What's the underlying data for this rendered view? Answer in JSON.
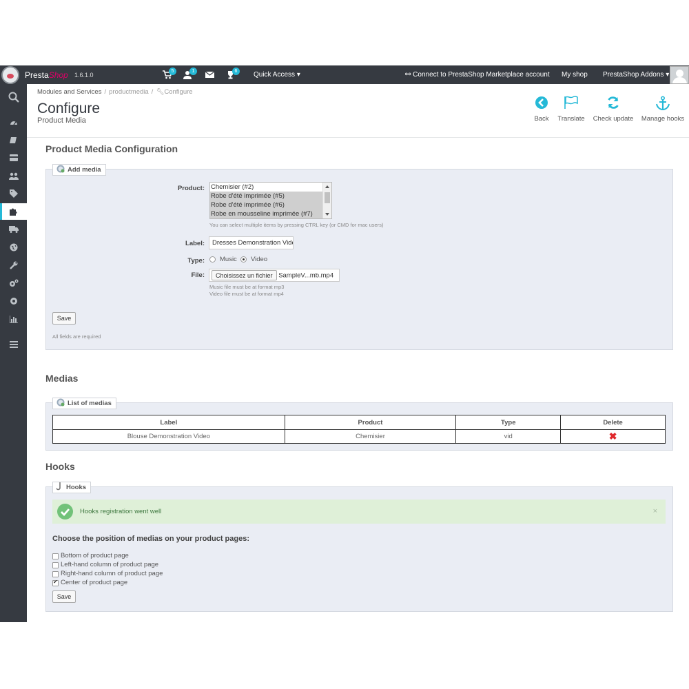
{
  "header": {
    "brand_prefix": "Presta",
    "brand_suffix": "Shop",
    "version": "1.6.1.0",
    "badges": {
      "orders": "5",
      "customers": "1",
      "achievements": "6"
    },
    "quick_access": "Quick Access",
    "connect": "Connect to PrestaShop Marketplace account",
    "my_shop": "My shop",
    "addons": "PrestaShop Addons"
  },
  "breadcrumb": {
    "item1": "Modules and Services",
    "item2": "productmedia",
    "item3": "Configure"
  },
  "page": {
    "title": "Configure",
    "subtitle": "Product Media"
  },
  "toolbar": {
    "back": "Back",
    "translate": "Translate",
    "check_update": "Check update",
    "manage_hooks": "Manage hooks"
  },
  "config": {
    "heading": "Product Media Configuration",
    "legend": "Add media",
    "product_label": "Product:",
    "product_options": [
      "Chemisier (#2)",
      "Robe d'été imprimée (#5)",
      "Robe d'été imprimée (#6)",
      "Robe en mousseline imprimée (#7)"
    ],
    "product_hint": "You can select multiple items by pressing CTRL key (or CMD for mac users)",
    "label_label": "Label:",
    "label_value": "Dresses Demonstration Video",
    "type_label": "Type:",
    "type_music": "Music",
    "type_video": "Video",
    "type_selected": "Video",
    "file_label": "File:",
    "file_button": "Choisissez un fichier",
    "file_name": "SampleV...mb.mp4",
    "file_hint_1": "Music file must be at format mp3",
    "file_hint_2": "Video file must be at format mp4",
    "save": "Save",
    "required": "All fields are required"
  },
  "medias": {
    "heading": "Medias",
    "legend": "List of medias",
    "columns": [
      "Label",
      "Product",
      "Type",
      "Delete"
    ],
    "rows": [
      {
        "label": "Blouse Demonstration Video",
        "product": "Chemisier",
        "type": "vid"
      }
    ]
  },
  "hooks": {
    "heading": "Hooks",
    "legend": "Hooks",
    "alert": "Hooks registration went well",
    "alert_close": "×",
    "choose": "Choose the position of medias on your product pages:",
    "options": [
      "Bottom of product page",
      "Left-hand column of product page",
      "Right-hand column of product page",
      "Center of product page"
    ],
    "checked": [
      false,
      false,
      false,
      true
    ],
    "save": "Save"
  },
  "colors": {
    "accent": "#25b9d7",
    "sidebar": "#363a41",
    "panel": "#eaedf4",
    "success_bg": "#dff0d8",
    "delete": "#e0282c"
  }
}
